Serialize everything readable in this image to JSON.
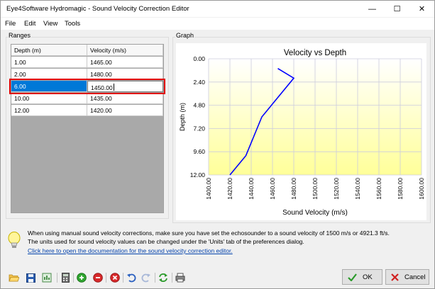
{
  "window": {
    "title": "Eye4Software Hydromagic - Sound Velocity Correction Editor",
    "minimize_glyph": "—",
    "maximize_glyph": "☐",
    "close_glyph": "✕"
  },
  "menu": [
    "File",
    "Edit",
    "View",
    "Tools"
  ],
  "ranges": {
    "group_label": "Ranges",
    "columns": [
      "Depth (m)",
      "Velocity (m/s)"
    ],
    "rows": [
      {
        "depth": "1.00",
        "velocity": "1465.00"
      },
      {
        "depth": "2.00",
        "velocity": "1480.00"
      },
      {
        "depth": "6.00",
        "velocity": "1450.00"
      },
      {
        "depth": "10.00",
        "velocity": "1435.00"
      },
      {
        "depth": "12.00",
        "velocity": "1420.00"
      }
    ],
    "selected_row": 2
  },
  "graph": {
    "group_label": "Graph",
    "colors": {
      "top": "#ffffff",
      "bottom": "#ffff99",
      "line": "#0000ff",
      "grid": "#ccccdd"
    }
  },
  "chart_data": {
    "type": "line",
    "title": "Velocity vs Depth",
    "xlabel": "Sound Velocity (m/s)",
    "ylabel": "Depth (m)",
    "xlim": [
      1400,
      1600
    ],
    "ylim": [
      0,
      12
    ],
    "x_ticks": [
      "1400.00",
      "1420.00",
      "1440.00",
      "1460.00",
      "1480.00",
      "1500.00",
      "1520.00",
      "1540.00",
      "1560.00",
      "1580.00",
      "1600.00"
    ],
    "y_ticks": [
      "0.00",
      "2.40",
      "4.80",
      "7.20",
      "9.60",
      "12.00"
    ],
    "y_inverted": true,
    "grid": true,
    "series": [
      {
        "points": [
          [
            1465,
            1
          ],
          [
            1480,
            2
          ],
          [
            1450,
            6
          ],
          [
            1435,
            10
          ],
          [
            1420,
            12
          ]
        ]
      }
    ]
  },
  "info": {
    "line1": "When using manual sound velocity corrections, make sure you have set the echosounder to a sound velocity of 1500 m/s or 4921.3 ft/s.",
    "line2": "The units used for sound velocity values can be changed under the 'Units' tab of the preferences dialog.",
    "link": "Click here to open the documentation for the sound velocity correction editor."
  },
  "toolbar": {
    "icons": [
      "open-folder-icon",
      "save-icon",
      "export-icon",
      "calculator-icon",
      "add-icon",
      "remove-icon",
      "delete-icon",
      "undo-icon",
      "redo-icon",
      "refresh-icon",
      "print-icon"
    ]
  },
  "buttons": {
    "ok": "OK",
    "cancel": "Cancel"
  }
}
